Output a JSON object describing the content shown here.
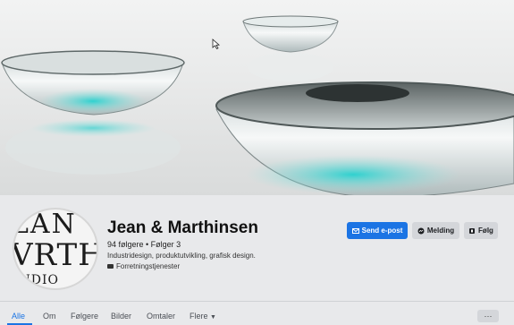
{
  "profile": {
    "name": "Jean & Marthinsen",
    "stats": "94 følgere • Følger 3",
    "description": "Industridesign, produktutvikling, grafisk design.",
    "category": "Forretningstjenester",
    "avatar_lines": [
      "LAN",
      "VRTH",
      "UDIO"
    ]
  },
  "actions": {
    "send_email": "Send e-post",
    "message": "Melding",
    "follow": "Følg"
  },
  "tabs": [
    "Alle",
    "Om",
    "Følgere",
    "Bilder",
    "Omtaler",
    "Flere"
  ],
  "more_menu": "···",
  "colors": {
    "accent": "#1b74e4",
    "cover_teal": "#2fc3c3"
  }
}
